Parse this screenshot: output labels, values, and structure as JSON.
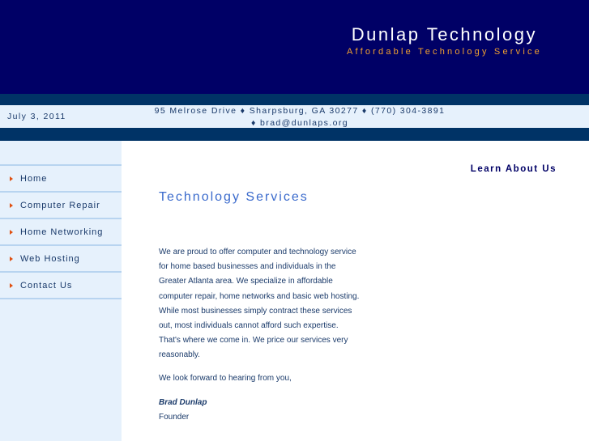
{
  "header": {
    "title": "Dunlap Technology",
    "tagline": "Affordable Technology Service"
  },
  "info": {
    "date": "July 3, 2011",
    "address": "95 Melrose Drive ♦ Sharpsburg, GA 30277 ♦ (770) 304-3891 ♦ brad@dunlaps.org"
  },
  "nav": [
    {
      "label": "Home"
    },
    {
      "label": "Computer Repair"
    },
    {
      "label": "Home Networking"
    },
    {
      "label": "Web Hosting"
    },
    {
      "label": "Contact Us"
    }
  ],
  "main": {
    "learn_link": "Learn About Us",
    "heading": "Technology Services",
    "paragraph1": "We are proud to offer computer and technology service for home based businesses and individuals in the Greater Atlanta area. We specialize in affordable computer repair, home networks and basic web hosting. While most businesses simply contract these services out, most individuals cannot afford such expertise. That's where we come in. We price our services very reasonably.",
    "paragraph2": "We look forward to hearing from you,",
    "signature_name": "Brad Dunlap",
    "signature_title": "Founder"
  }
}
